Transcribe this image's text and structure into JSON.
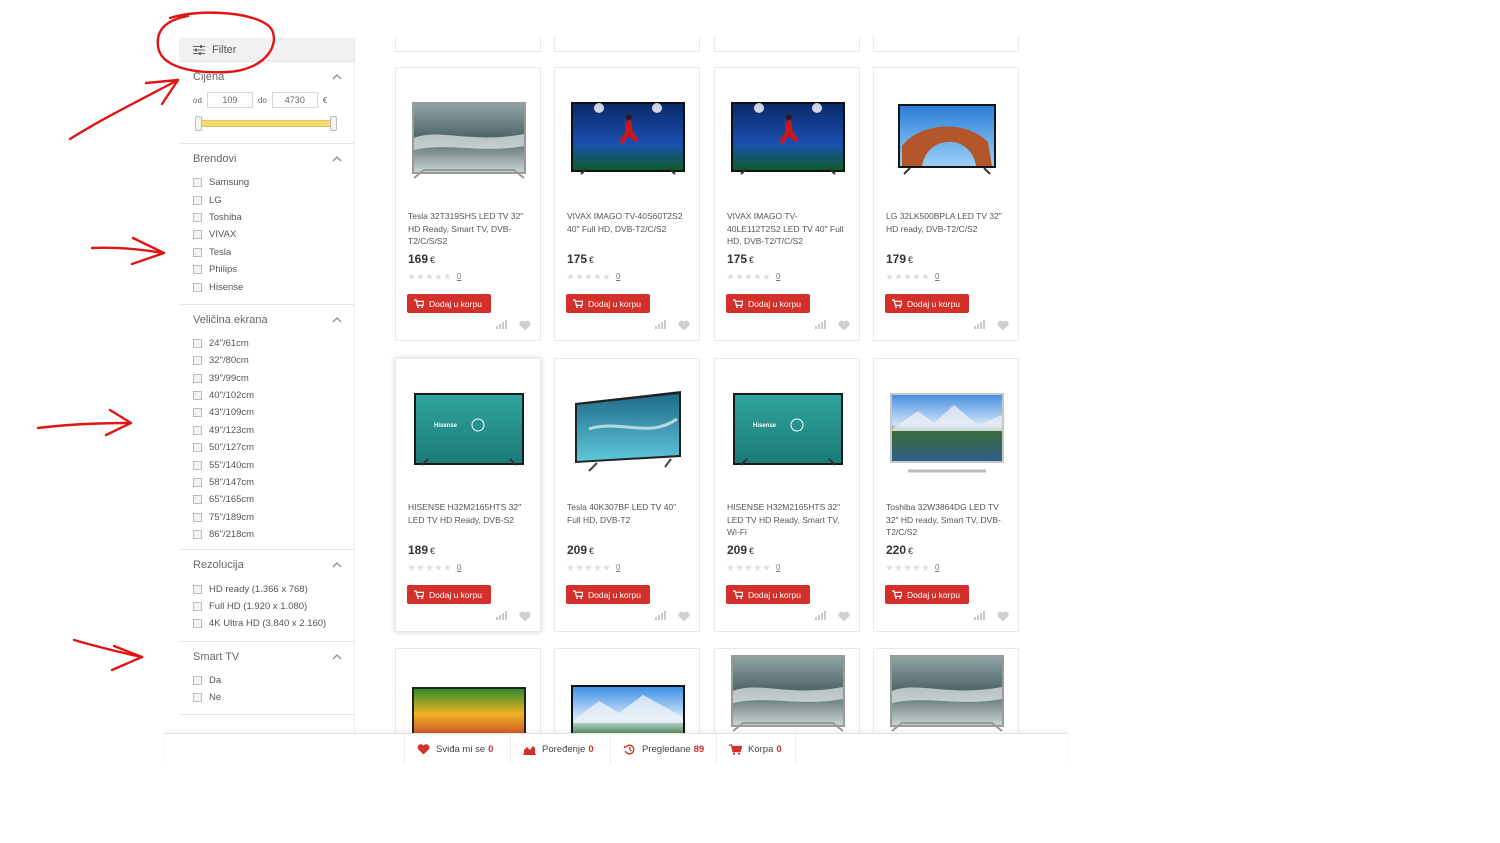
{
  "colors": {
    "accent": "#d3302b",
    "slider": "#f5d96a",
    "annotation": "#e01515"
  },
  "sidebar": {
    "filter_label": "Filter",
    "price": {
      "title": "Cijena",
      "from_label": "od",
      "from_value": "109",
      "to_label": "do",
      "to_value": "4730",
      "currency": "€"
    },
    "brands": {
      "title": "Brendovi",
      "options": [
        "Samsung",
        "LG",
        "Toshiba",
        "VIVAX",
        "Tesla",
        "Philips",
        "Hisense"
      ]
    },
    "screen_size": {
      "title": "Veličina ekrana",
      "options": [
        "24\"/61cm",
        "32\"/80cm",
        "39\"/99cm",
        "40\"/102cm",
        "43\"/109cm",
        "49\"/123cm",
        "50\"/127cm",
        "55\"/140cm",
        "58\"/147cm",
        "65\"/165cm",
        "75\"/189cm",
        "86\"/218cm"
      ]
    },
    "resolution": {
      "title": "Rezolucija",
      "options": [
        "HD ready (1.366 x 768)",
        "Full HD (1.920 x 1.080)",
        "4K Ultra HD (3.840 x 2.160)"
      ]
    },
    "smart_tv": {
      "title": "Smart TV",
      "options": [
        "Da",
        "Ne"
      ]
    }
  },
  "products": {
    "add_to_cart_label": "Dodaj u korpu",
    "currency": "€",
    "row1": [
      {
        "name": "Tesla 32T319SHS LED TV 32\" HD Ready, Smart TV, DVB-T2/C/S/S2",
        "price": "169",
        "reviews": "0",
        "image": "tv-ocean-silver"
      },
      {
        "name": "VIVAX IMAGO TV-40S60T2S2 40\" Full HD, DVB-T2/C/S2",
        "price": "175",
        "reviews": "0",
        "image": "tv-football"
      },
      {
        "name": "VIVAX IMAGO TV-40LE112T2S2 LED TV 40\" Full HD, DVB-T2/T/C/S2",
        "price": "175",
        "reviews": "0",
        "image": "tv-football"
      },
      {
        "name": "LG 32LK500BPLA LED TV 32\" HD ready, DVB-T2/C/S2",
        "price": "179",
        "reviews": "0",
        "image": "tv-arch"
      }
    ],
    "row2": [
      {
        "name": "HISENSE H32M2165HTS 32\" LED TV HD Ready, DVB-S2",
        "price": "189",
        "reviews": "0",
        "image": "tv-hisense",
        "brand_text": "Hisense"
      },
      {
        "name": "Tesla 40K307BF LED TV 40\" Full HD, DVB-T2",
        "price": "209",
        "reviews": "0",
        "image": "tv-ocean-angled"
      },
      {
        "name": "HISENSE H32M2165HTS 32\" LED TV HD Ready, Smart TV, Wi-Fi",
        "price": "209",
        "reviews": "0",
        "image": "tv-hisense",
        "brand_text": "Hisense"
      },
      {
        "name": "Toshiba 32W3864DG LED TV 32\" HD ready, Smart TV, DVB-T2/C/S2",
        "price": "220",
        "reviews": "0",
        "image": "tv-lake"
      }
    ],
    "row3": [
      {
        "image": "tv-sunset"
      },
      {
        "image": "tv-mountain"
      },
      {
        "image": "tv-ocean-silver"
      },
      {
        "image": "tv-ocean-silver"
      }
    ]
  },
  "bottom_bar": {
    "likes": {
      "label": "Sviđa mi se",
      "count": "0",
      "icon": "heart-icon"
    },
    "compare": {
      "label": "Poređenje",
      "count": "0",
      "icon": "chart-icon"
    },
    "viewed": {
      "label": "Pregledane",
      "count": "89",
      "icon": "history-icon"
    },
    "cart": {
      "label": "Korpa",
      "count": "0",
      "icon": "cart-icon"
    }
  }
}
